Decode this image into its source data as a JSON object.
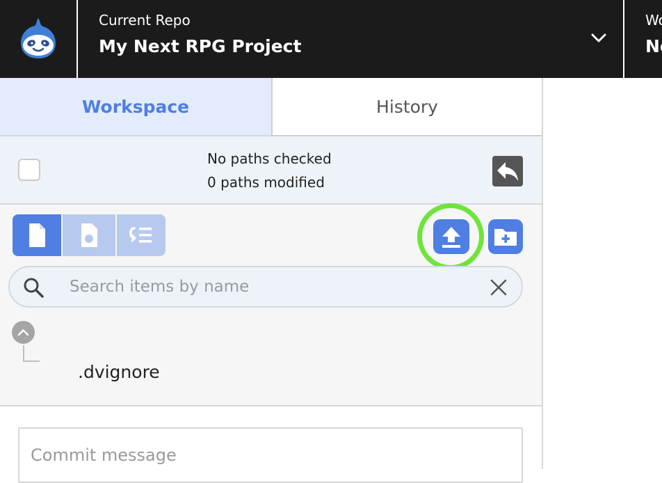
{
  "header": {
    "repo_caption": "Current Repo",
    "repo_name": "My Next RPG Project",
    "workspace_caption": "Workspace",
    "workspace_name": "No"
  },
  "tabs": [
    {
      "label": "Workspace",
      "active": true
    },
    {
      "label": "History",
      "active": false
    }
  ],
  "status": {
    "checked_text": "No paths checked",
    "modified_text": "0 paths modified"
  },
  "toolbar": {
    "view_modes": [
      "file-icon",
      "file-modified-icon",
      "list-indent-icon"
    ],
    "active_view_mode": 0,
    "highlighted_button": "upload-button"
  },
  "search": {
    "placeholder": "Search items by name",
    "value": ""
  },
  "tree": {
    "items": [
      {
        "name": ".dvignore",
        "checked": false
      }
    ]
  },
  "commit": {
    "placeholder": "Commit message"
  },
  "colors": {
    "accent": "#4f7fe3",
    "accent_light": "#b8c9f0",
    "highlight_ring": "#6fe43d",
    "topbar": "#1b1b1b",
    "active_tab_bg": "#e3ecfa"
  }
}
